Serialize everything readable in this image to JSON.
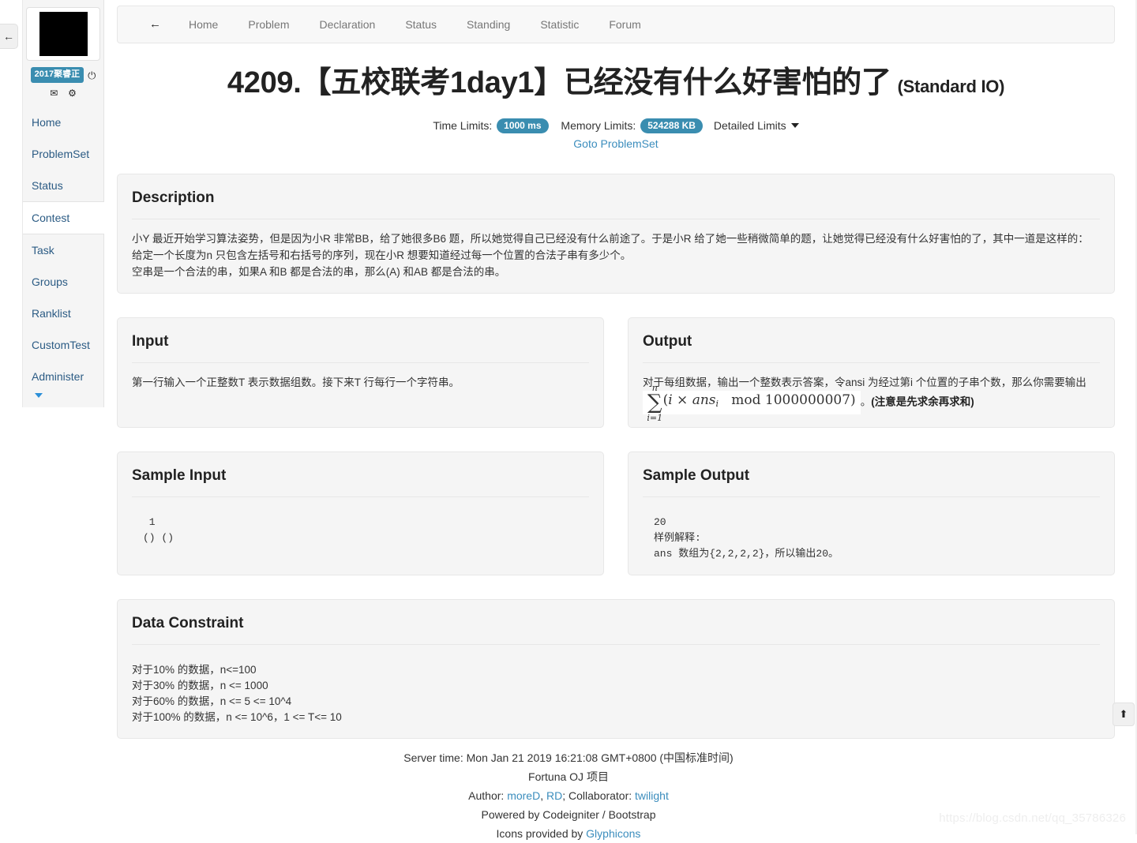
{
  "sidebar": {
    "avatar_name": "user-avatar",
    "user_badge": "2017聚睿正",
    "power_icon": "⏻",
    "mail_icon": "✉",
    "gear_icon": "⚙",
    "items": [
      {
        "label": "Home",
        "active": false
      },
      {
        "label": "ProblemSet",
        "active": false
      },
      {
        "label": "Status",
        "active": false
      },
      {
        "label": "Contest",
        "active": true
      },
      {
        "label": "Task",
        "active": false
      },
      {
        "label": "Groups",
        "active": false
      },
      {
        "label": "Ranklist",
        "active": false
      },
      {
        "label": "CustomTest",
        "active": false
      },
      {
        "label": "Administer",
        "active": false
      }
    ]
  },
  "collapse_tab": {
    "icon": "←"
  },
  "navbar": {
    "back_icon": "←",
    "items": [
      "Home",
      "Problem",
      "Declaration",
      "Status",
      "Standing",
      "Statistic",
      "Forum"
    ]
  },
  "header": {
    "title": "4209.【五校联考1day1】已经没有什么好害怕的了",
    "io_type": "(Standard IO)",
    "time_limits_label": "Time Limits:",
    "time_limits_value": "1000 ms",
    "memory_limits_label": "Memory Limits:",
    "memory_limits_value": "524288 KB",
    "detailed_limits": "Detailed Limits",
    "goto_problemset": "Goto ProblemSet"
  },
  "description": {
    "heading": "Description",
    "paragraphs": [
      "小Y 最近开始学习算法姿势，但是因为小R 非常BB，给了她很多B6 题，所以她觉得自己已经没有什么前途了。于是小R 给了她一些稍微简单的题，让她觉得已经没有什么好害怕的了，其中一道是这样的：",
      "给定一个长度为n 只包含左括号和右括号的序列，现在小R 想要知道经过每一个位置的合法子串有多少个。",
      "空串是一个合法的串，如果A 和B 都是合法的串，那么(A) 和AB 都是合法的串。"
    ]
  },
  "input": {
    "heading": "Input",
    "text": "第一行输入一个正整数T 表示数据组数。接下来T 行每行一个字符串。"
  },
  "output": {
    "heading": "Output",
    "text_before": "对于每组数据，输出一个整数表示答案，令ansi 为经过第i 个位置的子串个数，那么你需要输出 ",
    "formula": {
      "sum_upper": "n",
      "sum_lower": "i=1",
      "body": "( i × ans_i   mod 1000000007 )"
    },
    "text_after": "。",
    "note": "(注意是先求余再求和)"
  },
  "sample_input": {
    "heading": "Sample Input",
    "text": " 1\n() ()"
  },
  "sample_output": {
    "heading": "Sample Output",
    "text": "20\n样例解释:\nans 数组为{2,2,2,2}，所以输出20。"
  },
  "data_constraint": {
    "heading": "Data Constraint",
    "lines": [
      "对于10% 的数据，n<=100",
      "对于30% 的数据，n <= 1000",
      "对于60% 的数据，n <= 5 <= 10^4",
      "对于100% 的数据，n <= 10^6，1 <= T<= 10"
    ]
  },
  "footer": {
    "server_time": "Server time: Mon Jan 21 2019 16:21:08 GMT+0800 (中国标准时间)",
    "project": "Fortuna OJ 项目",
    "author_label": "Author:",
    "author_1": "moreD",
    "author_sep": ", ",
    "author_2": "RD",
    "collaborator_label": "; Collaborator:",
    "collaborator": "twilight",
    "powered": "Powered by Codeigniter / Bootstrap",
    "icons_label": "Icons provided by",
    "icons_link": "Glyphicons"
  },
  "scroll_top": {
    "icon": "⬆"
  },
  "watermark": "https://blog.csdn.net/qq_35786326",
  "colors": {
    "accent": "#3a8db0",
    "link": "#3b8dbd",
    "nav_link": "#2b5b84",
    "panel_bg": "#f5f5f5",
    "panel_border": "#e7e7e7"
  }
}
